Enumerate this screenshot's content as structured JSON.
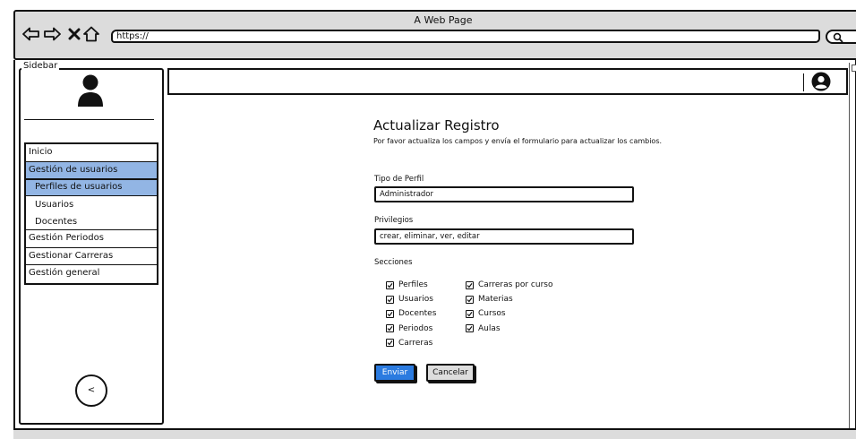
{
  "browser": {
    "title": "A Web Page",
    "url": "https://"
  },
  "sidebar": {
    "label": "Sidebar",
    "menu": [
      {
        "label": "Inicio",
        "active": false,
        "sub": false
      },
      {
        "label": "Gestión de usuarios",
        "active": true,
        "sub": false
      },
      {
        "label": "Perfiles de usuarios",
        "active": true,
        "sub": true
      },
      {
        "label": "Usuarios",
        "active": false,
        "sub": true
      },
      {
        "label": "Docentes",
        "active": false,
        "sub": true
      },
      {
        "label": "Gestión Periodos",
        "active": false,
        "sub": false
      },
      {
        "label": "Gestionar Carreras",
        "active": false,
        "sub": false
      },
      {
        "label": "Gestión general",
        "active": false,
        "sub": false
      }
    ],
    "collapse_label": "<"
  },
  "form": {
    "title": "Actualizar Registro",
    "subtitle": "Por favor actualiza los campos y envía el formulario para actualizar los cambios.",
    "perfil_label": "Tipo de Perfil",
    "perfil_value": "Administrador",
    "privilegios_label": "Privilegios",
    "privilegios_value": "crear, eliminar, ver, editar",
    "secciones_label": "Secciones",
    "secciones_col1": [
      "Perfiles",
      "Usuarios",
      "Docentes",
      "Periodos",
      "Carreras"
    ],
    "secciones_col2": [
      "Carreras por curso",
      "Materias",
      "Cursos",
      "Aulas"
    ],
    "submit_label": "Enviar",
    "cancel_label": "Cancelar"
  },
  "colors": {
    "active_menu": "#92b5e4",
    "primary_button": "#2b7be0",
    "chrome": "#dcdcdc"
  }
}
